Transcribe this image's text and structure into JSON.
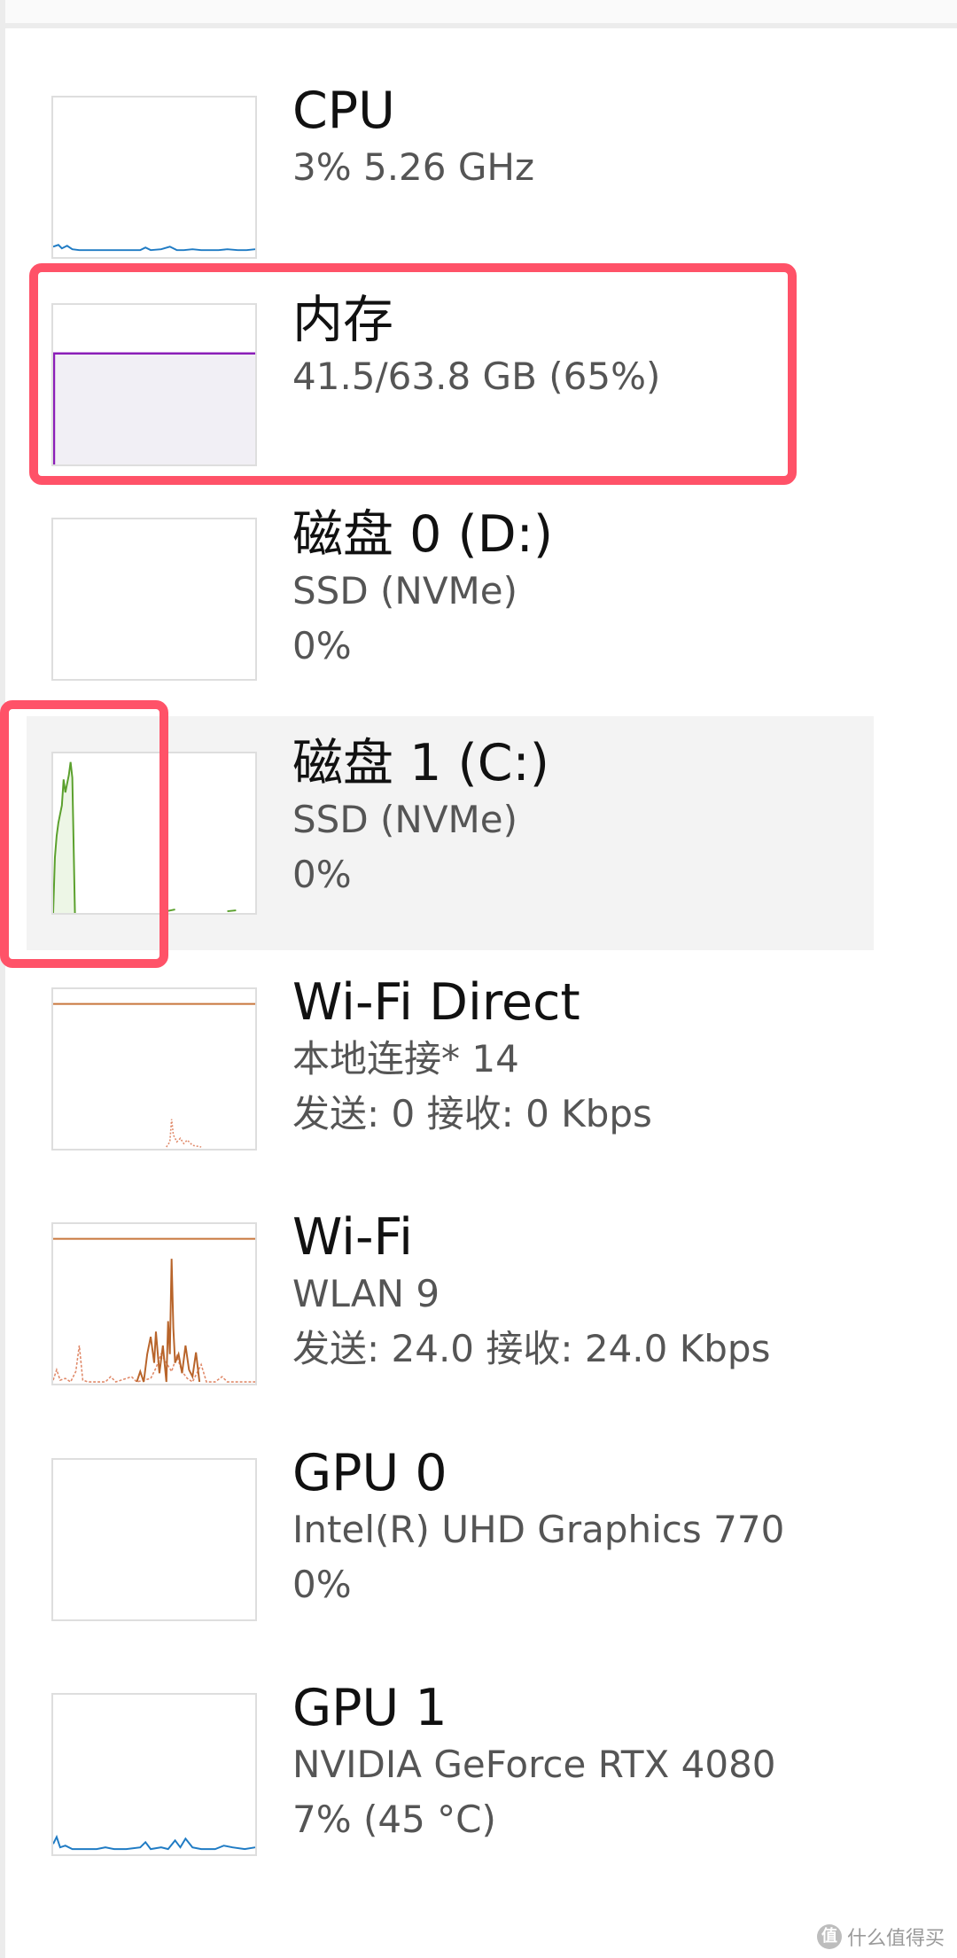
{
  "items": [
    {
      "id": "cpu",
      "title": "CPU",
      "lines": [
        "3%  5.26 GHz"
      ],
      "graph": {
        "type": "line",
        "color": "#1f7bc4",
        "fill": "none",
        "utilization_percent": 3
      }
    },
    {
      "id": "memory",
      "title": "内存",
      "lines": [
        "41.5/63.8 GB (65%)"
      ],
      "graph": {
        "type": "area",
        "color": "#8b1eb8",
        "fill": "#f1eff5",
        "utilization_percent": 65
      }
    },
    {
      "id": "disk0",
      "title": "磁盘 0 (D:)",
      "lines": [
        "SSD (NVMe)",
        "0%"
      ],
      "graph": {
        "type": "empty",
        "color": "#5aa02c",
        "fill": "none",
        "utilization_percent": 0
      }
    },
    {
      "id": "disk1",
      "title": "磁盘 1 (C:)",
      "lines": [
        "SSD (NVMe)",
        "0%"
      ],
      "graph": {
        "type": "area",
        "color": "#5aa02c",
        "fill": "#edf6e6",
        "utilization_percent": 0
      }
    },
    {
      "id": "wifi-direct",
      "title": "Wi-Fi Direct",
      "lines": [
        "本地连接* 14",
        "发送: 0  接收: 0 Kbps"
      ],
      "graph": {
        "type": "network",
        "color": "#c8763c",
        "fill": "none",
        "utilization_percent": 0
      }
    },
    {
      "id": "wifi",
      "title": "Wi-Fi",
      "lines": [
        "WLAN 9",
        "发送: 24.0  接收: 24.0 Kbps"
      ],
      "graph": {
        "type": "network",
        "color": "#b8642a",
        "fill": "none",
        "utilization_percent": 0
      }
    },
    {
      "id": "gpu0",
      "title": "GPU 0",
      "lines": [
        "Intel(R) UHD Graphics 770",
        "0%"
      ],
      "graph": {
        "type": "empty",
        "color": "#1f7bc4",
        "fill": "none",
        "utilization_percent": 0
      }
    },
    {
      "id": "gpu1",
      "title": "GPU 1",
      "lines": [
        "NVIDIA GeForce RTX 4080",
        "7%  (45 °C)"
      ],
      "graph": {
        "type": "line",
        "color": "#1f7bc4",
        "fill": "none",
        "utilization_percent": 7
      }
    }
  ],
  "selected_item": "disk1",
  "highlight_color": "#ff5268",
  "watermark": {
    "icon_text": "值",
    "text": "什么值得买"
  }
}
